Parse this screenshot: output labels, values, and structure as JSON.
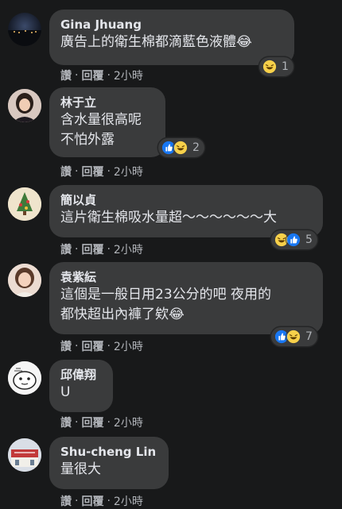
{
  "comments": [
    {
      "name": "Gina Jhuang",
      "lines": [
        "廣告上的衛生棉都滴藍色液體😂"
      ],
      "reactions": [
        "haha"
      ],
      "count": "1",
      "like": "讚",
      "reply": "回覆",
      "time": "2小時"
    },
    {
      "name": "林于立",
      "lines": [
        "含水量很高呢",
        "不怕外露"
      ],
      "reactions": [
        "like",
        "haha"
      ],
      "count": "2",
      "like": "讚",
      "reply": "回覆",
      "time": "2小時"
    },
    {
      "name": "簡以貞",
      "lines": [
        "這片衛生棉吸水量超～～～～～～大"
      ],
      "reactions": [
        "haha",
        "like"
      ],
      "count": "5",
      "like": "讚",
      "reply": "回覆",
      "time": "2小時"
    },
    {
      "name": "袁紫紜",
      "lines": [
        "這個是一般日用23公分的吧 夜用的",
        "都快超出內褲了欸😂"
      ],
      "reactions": [
        "like",
        "haha"
      ],
      "count": "7",
      "like": "讚",
      "reply": "回覆",
      "time": "2小時"
    },
    {
      "name": "邱偉翔",
      "lines": [
        "U"
      ],
      "reactions": [],
      "count": "",
      "like": "讚",
      "reply": "回覆",
      "time": "2小時"
    },
    {
      "name": "Shu-cheng Lin",
      "lines": [
        "量很大"
      ],
      "reactions": [],
      "count": "",
      "like": "讚",
      "reply": "回覆",
      "time": "2小時"
    }
  ]
}
